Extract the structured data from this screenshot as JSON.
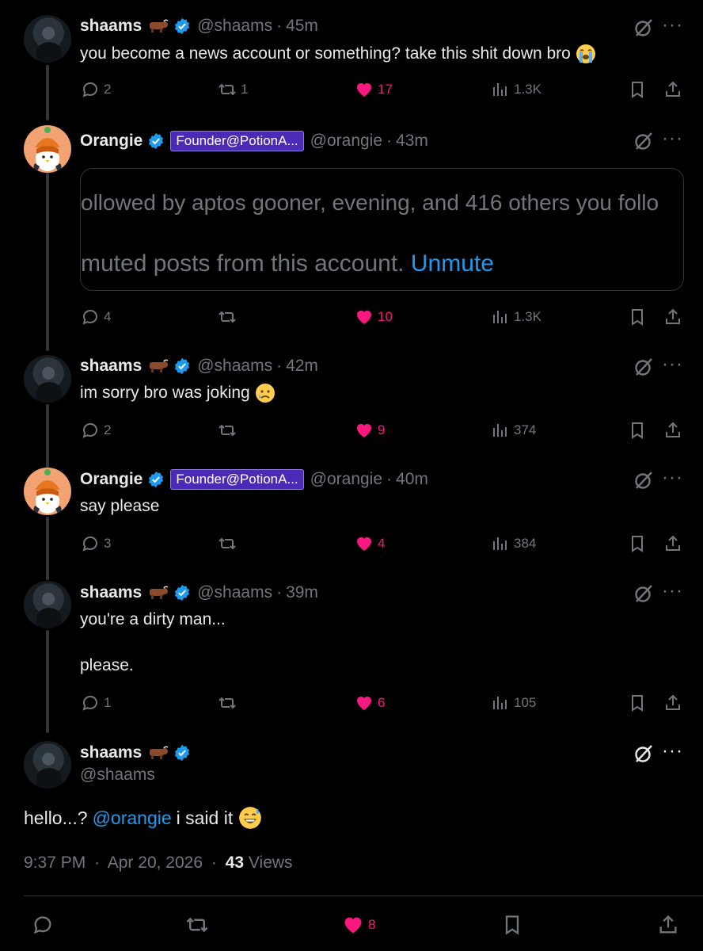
{
  "colors": {
    "background": "#000000",
    "text": "#e7e9ea",
    "muted": "#71767b",
    "accent": "#1d9bf0",
    "like": "#f91880",
    "affiliate_bg": "#4b2bb5"
  },
  "replies": [
    {
      "name": "shaams",
      "handle": "@shaams",
      "time": "45m",
      "text": "you become a news account or something? take this shit down bro",
      "emoji": "loudly-crying-face",
      "replies": "2",
      "reposts": "1",
      "likes": "17",
      "views": "1.3K"
    },
    {
      "name": "Orangie",
      "affiliate": "Founder@PotionA...",
      "handle": "@orangie",
      "time": "43m",
      "muted_line1": "ollowed by aptos gooner, evening, and 416 others you follo",
      "muted_line2": "muted posts from this account.",
      "unmute": "Unmute",
      "replies": "4",
      "reposts": "",
      "likes": "10",
      "views": "1.3K"
    },
    {
      "name": "shaams",
      "handle": "@shaams",
      "time": "42m",
      "text": "im sorry bro was joking",
      "emoji": "sad-but-relieved-face",
      "replies": "2",
      "reposts": "",
      "likes": "9",
      "views": "374"
    },
    {
      "name": "Orangie",
      "affiliate": "Founder@PotionA...",
      "handle": "@orangie",
      "time": "40m",
      "text": "say please",
      "replies": "3",
      "reposts": "",
      "likes": "4",
      "views": "384"
    },
    {
      "name": "shaams",
      "handle": "@shaams",
      "time": "39m",
      "text": "you're a dirty man...\n\nplease.",
      "replies": "1",
      "reposts": "",
      "likes": "6",
      "views": "105"
    }
  ],
  "main": {
    "name": "shaams",
    "handle": "@shaams",
    "text_before": "hello...?",
    "mention": "@orangie",
    "text_after": "i said it",
    "emoji": "grinning-face-with-sweat",
    "time": "9:37 PM",
    "date": "Apr 20, 2026",
    "views_count": "43",
    "views_label": "Views",
    "likes": "8"
  },
  "separator": "·"
}
